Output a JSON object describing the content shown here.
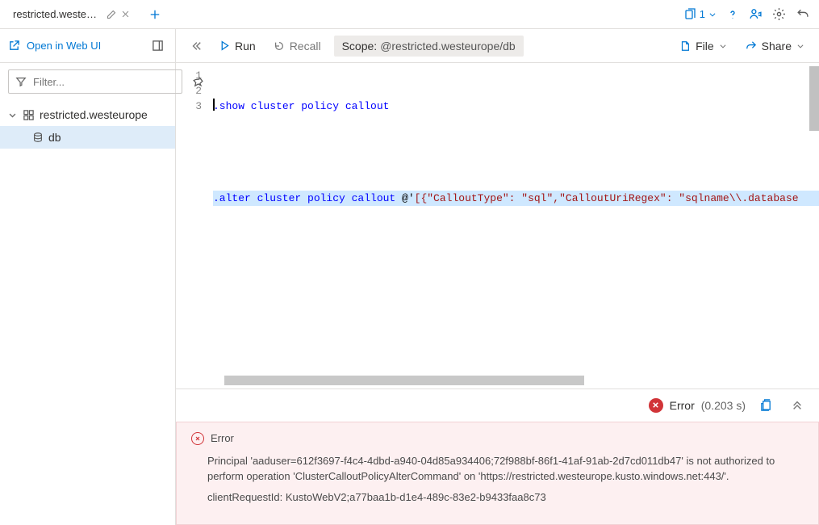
{
  "tabs": {
    "items": [
      {
        "title": "restricted.westeur…"
      }
    ],
    "plus_name": "new-tab"
  },
  "top_icons": {
    "copy_count": "1",
    "help": "?",
    "feedback": "feedback",
    "settings": "settings",
    "undo": "undo"
  },
  "sidebar": {
    "open_web_label": "Open in Web UI",
    "filter_placeholder": "Filter...",
    "tree": {
      "cluster": "restricted.westeurope",
      "db": "db"
    }
  },
  "toolbar": {
    "run_label": "Run",
    "recall_label": "Recall",
    "scope_key": "Scope:",
    "scope_value": "@restricted.westeurope/db",
    "file_label": "File",
    "share_label": "Share"
  },
  "editor": {
    "gutter": [
      "1",
      "2",
      "3"
    ],
    "line1": {
      "cmd": ".show cluster policy callout"
    },
    "line2": "",
    "line3": {
      "cmd": ".alter cluster policy callout",
      "op": " @'",
      "str": "[{\"CalloutType\": \"sql\",\"CalloutUriRegex\": \"sqlname\\\\.database"
    }
  },
  "results": {
    "status_label": "Error",
    "timing": "(0.203 s)",
    "panel_title": "Error",
    "message": "Principal 'aaduser=612f3697-f4c4-4dbd-a940-04d85a934406;72f988bf-86f1-41af-91ab-2d7cd011db47' is not authorized to perform operation 'ClusterCalloutPolicyAlterCommand' on 'https://restricted.westeurope.kusto.windows.net:443/'.",
    "request_id": "clientRequestId: KustoWebV2;a77baa1b-d1e4-489c-83e2-b9433faa8c73"
  }
}
